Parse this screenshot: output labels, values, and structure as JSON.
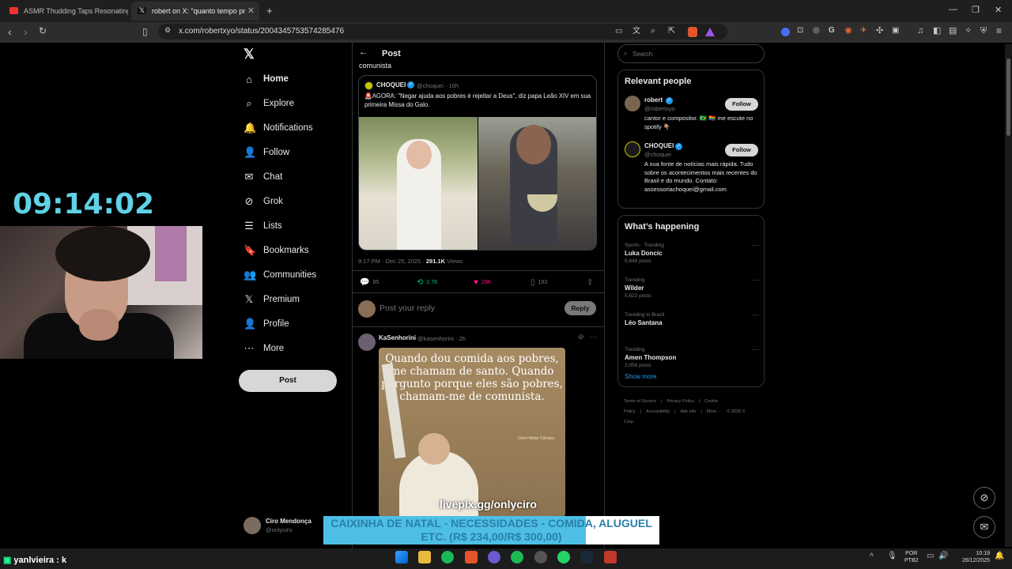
{
  "browser": {
    "tabs": [
      {
        "title": "ASMR Thudding Taps Resonating in V"
      },
      {
        "title": "robert on X: \"quanto tempo pro"
      }
    ],
    "new_tab": "+",
    "url": "x.com/robertxyo/status/2004345753574285476"
  },
  "stream": {
    "clock": "09:14:02",
    "livepix": "livepix.gg/onlyciro",
    "banner_text": "CAIXINHA DE NATAL - NECESSIDADES - COMIDA, ALUGUEL ETC. (R$ 234,00/R$ 300,00)",
    "banner_progress": 0.78,
    "chat_line": "yanlvieira : k"
  },
  "sidebar": {
    "logo": "𝕏",
    "items": [
      {
        "label": "Home",
        "icon": "home-icon",
        "glyph": "⌂"
      },
      {
        "label": "Explore",
        "icon": "search-icon",
        "glyph": "⌕"
      },
      {
        "label": "Notifications",
        "icon": "bell-icon",
        "glyph": "🔔"
      },
      {
        "label": "Follow",
        "icon": "person-plus-icon",
        "glyph": "👤"
      },
      {
        "label": "Chat",
        "icon": "mail-icon",
        "glyph": "✉"
      },
      {
        "label": "Grok",
        "icon": "grok-icon",
        "glyph": "⊘"
      },
      {
        "label": "Lists",
        "icon": "list-icon",
        "glyph": "☰"
      },
      {
        "label": "Bookmarks",
        "icon": "bookmark-icon",
        "glyph": "🔖"
      },
      {
        "label": "Communities",
        "icon": "communities-icon",
        "glyph": "👥"
      },
      {
        "label": "Premium",
        "icon": "x-premium-icon",
        "glyph": "𝕏"
      },
      {
        "label": "Profile",
        "icon": "profile-icon",
        "glyph": "👤"
      },
      {
        "label": "More",
        "icon": "more-circle-icon",
        "glyph": "⋯"
      }
    ],
    "post_button": "Post",
    "account": {
      "name": "Ciro Mendonça",
      "handle": "@onlyciro"
    }
  },
  "header": {
    "back": "←",
    "title": "Post"
  },
  "main_tweet": {
    "text_tail": "comunista",
    "quote": {
      "name": "CHOQUEI",
      "handle": "@choquei · 16h",
      "text": "🚨AGORA: \"Negar ajuda aos pobres é rejeitar a Deus\", diz papa Leão XIV em sua primeira Missa do Galo."
    },
    "meta_time": "9:17 PM · Dec 25, 2025 · ",
    "views_num": "291.1K",
    "views_label": " Views",
    "stats": {
      "replies": "85",
      "reposts": "2.7K",
      "likes": "29K",
      "bookmarks": "193"
    }
  },
  "reply_box": {
    "placeholder": "Post your reply",
    "button": "Reply"
  },
  "reply_tweet": {
    "name": "KaSenhorini",
    "handle": "@kasenhorini · 2h",
    "poster_quote": "Quando dou comida aos pobres, me chamam de santo. Quando pergunto porque eles são pobres, chamam-me de comunista.",
    "poster_sig": "Dom Hélder Câmara"
  },
  "right": {
    "search_placeholder": "Search",
    "relevant_title": "Relevant people",
    "people": [
      {
        "name": "robert",
        "handle": "@robertxyo",
        "bio": "cantor e compositor. 🇧🇷 🏳️‍🌈 me escute no spotify 👇🏽",
        "follow": "Follow"
      },
      {
        "name": "CHOQUEI",
        "handle": "@choquei",
        "bio": "A sua fonte de notícias mais rápida. Tudo sobre os acontecimentos mais recentes do Brasil e do mundo. Contato: assessoriachoquei@gmail.com",
        "follow": "Follow"
      }
    ],
    "happening_title": "What’s happening",
    "trends": [
      {
        "context": "Sports · Trending",
        "name": "Luka Doncic",
        "count": "5,848 posts"
      },
      {
        "context": "Trending",
        "name": "Wilder",
        "count": "5,622 posts"
      },
      {
        "context": "Trending in Brazil",
        "name": "Léo Santana",
        "count": ""
      },
      {
        "context": "Trending",
        "name": "Amen Thompson",
        "count": "2,056 posts"
      }
    ],
    "show_more": "Show more",
    "footer": [
      "Terms of Service",
      "|",
      "Privacy Policy",
      "|",
      "Cookie Policy",
      "|",
      "Accessibility",
      "|",
      "Ads info",
      "|",
      "More ···",
      "© 2025 X Corp."
    ]
  },
  "taskbar": {
    "lang": "POR",
    "lang2": "PTB2",
    "time": "10:19",
    "date": "26/12/2025",
    "tray_up": "^"
  }
}
